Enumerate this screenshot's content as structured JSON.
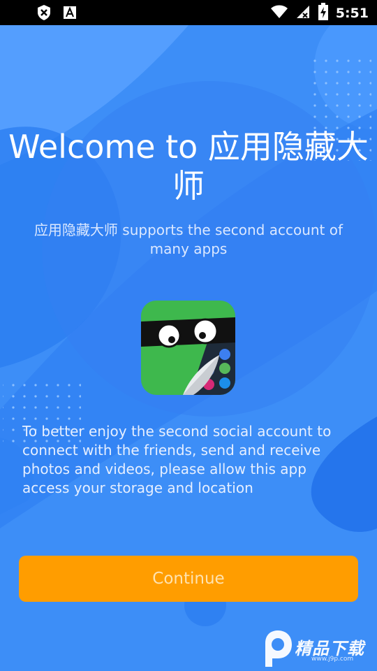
{
  "status_bar": {
    "time": "5:51",
    "icons": [
      "shield-icon",
      "font-a-icon",
      "wifi-icon",
      "no-signal-icon",
      "battery-charging-icon"
    ]
  },
  "welcome": {
    "title": "Welcome to 应用隐藏大师",
    "subtitle": "应用隐藏大师 supports the second account of many apps",
    "description": "To better enjoy the second social account to connect with the friends, send and receive photos and videos, please allow this app access your storage and location"
  },
  "continue_button": {
    "label": "Continue"
  },
  "watermark": {
    "text": "精品下载",
    "url": "www.j9p.com"
  },
  "colors": {
    "background": "#3a8cf6",
    "button": "#ff9d00",
    "button_text": "#ffe3b0"
  }
}
